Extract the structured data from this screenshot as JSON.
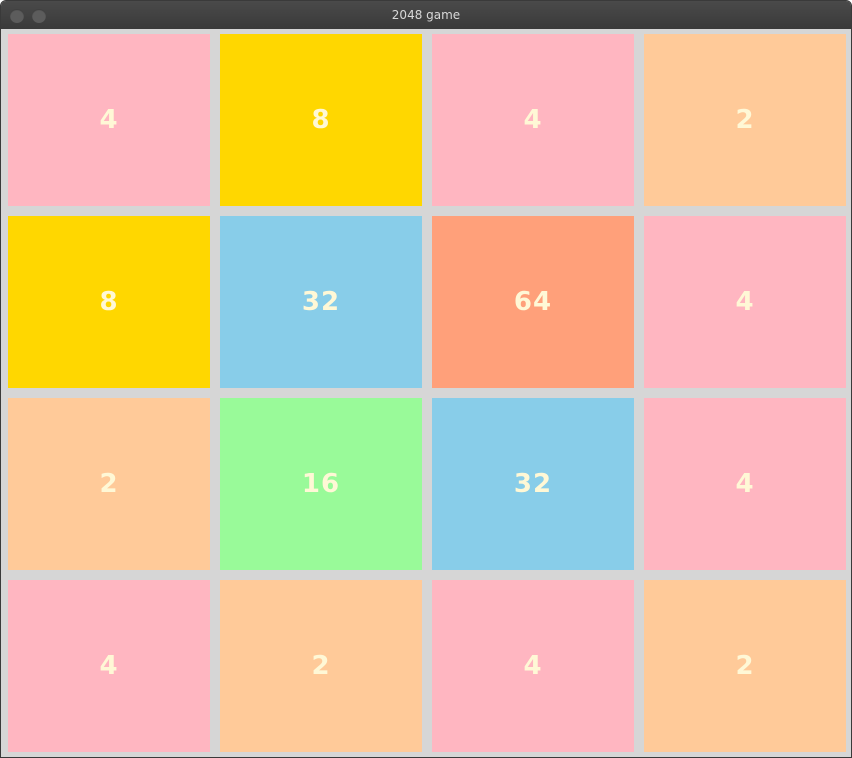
{
  "window": {
    "title": "2048 game"
  },
  "colors": {
    "tile_2": "#ffca99",
    "tile_4": "#ffb6c1",
    "tile_8": "#ffd700",
    "tile_16": "#99fa99",
    "tile_32": "#88cde9",
    "tile_64": "#ffa07a",
    "board_background": "#d6d6d6",
    "tile_text": "#fff8d6"
  },
  "board": {
    "rows": [
      [
        "4",
        "8",
        "4",
        "2"
      ],
      [
        "8",
        "32",
        "64",
        "4"
      ],
      [
        "2",
        "16",
        "32",
        "4"
      ],
      [
        "4",
        "2",
        "4",
        "2"
      ]
    ]
  }
}
